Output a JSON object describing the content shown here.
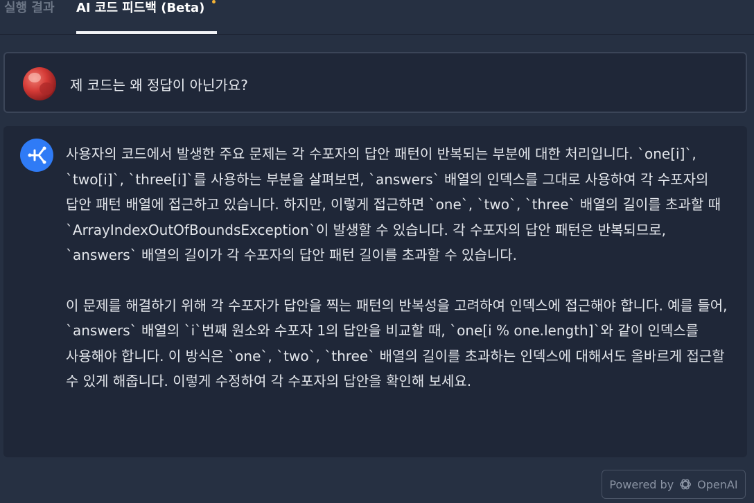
{
  "tabs": [
    {
      "label": "실행 결과",
      "active": false
    },
    {
      "label": "AI 코드 피드백 (Beta)",
      "active": true
    }
  ],
  "question": {
    "text": "제 코드는 왜 정답이 아닌가요?"
  },
  "answer": {
    "paragraphs": [
      "사용자의 코드에서 발생한 주요 문제는 각 수포자의 답안 패턴이 반복되는 부분에 대한 처리입니다. `one[i]`, `two[i]`, `three[i]`를 사용하는 부분을 살펴보면, `answers` 배열의 인덱스를 그대로 사용하여 각 수포자의 답안 패턴 배열에 접근하고 있습니다. 하지만, 이렇게 접근하면 `one`, `two`, `three` 배열의 길이를 초과할 때 `ArrayIndexOutOfBoundsException`이 발생할 수 있습니다. 각 수포자의 답안 패턴은 반복되므로, `answers` 배열의 길이가 각 수포자의 답안 패턴 길이를 초과할 수 있습니다.",
      "이 문제를 해결하기 위해 각 수포자가 답안을 찍는 패턴의 반복성을 고려하여 인덱스에 접근해야 합니다. 예를 들어, `answers` 배열의 `i`번째 원소와 수포자 1의 답안을 비교할 때, `one[i % one.length]`와 같이 인덱스를 사용해야 합니다. 이 방식은 `one`, `two`, `three` 배열의 길이를 초과하는 인덱스에 대해서도 올바르게 접근할 수 있게 해줍니다. 이렇게 수정하여 각 수포자의 답안을 확인해 보세요."
    ]
  },
  "footer": {
    "powered_by": "Powered by",
    "brand": "OpenAI"
  },
  "colors": {
    "background": "#263042",
    "card": "#1f2738",
    "bot_accent": "#2f7bf6",
    "tab_dot": "#f5b335"
  },
  "icons": {
    "avatar": "user-avatar",
    "bot": "ai-bot-icon",
    "brand": "openai-icon"
  }
}
